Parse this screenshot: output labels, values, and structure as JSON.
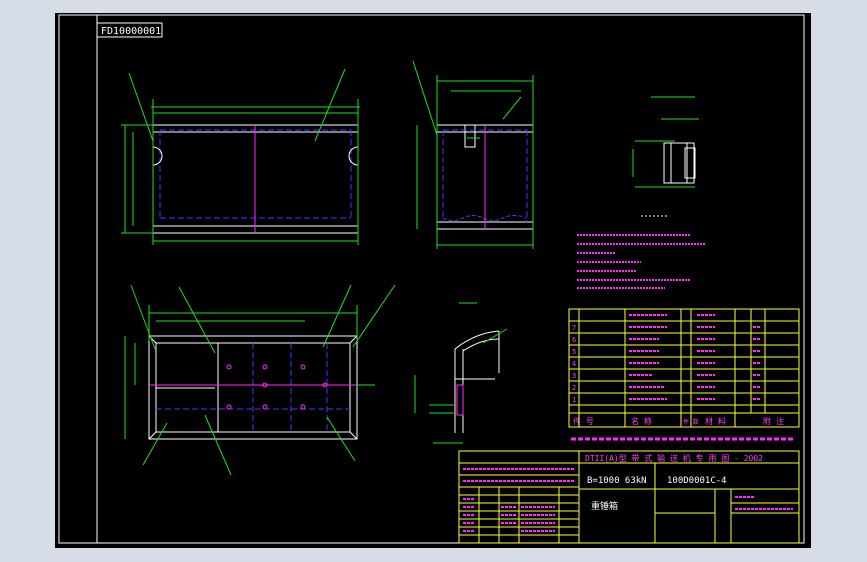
{
  "drawing": {
    "drawing_code": "FD10000001",
    "spec": "B=1000 63kN",
    "drawing_no": "100D0001C-4",
    "standard_title": "DTII(A)型   带 式 输 送 机 专 用 图 - 2002",
    "part_name": "重锤箱",
    "bom_header": [
      "件  号",
      "名    称",
      "件  数",
      "材    料",
      "附    注"
    ],
    "part_numbers": [
      "7",
      "6",
      "5",
      "4",
      "3",
      "2",
      "1"
    ]
  },
  "colors": {
    "background": "#000000",
    "frame": "#ffffff",
    "dimension": "#22dd22",
    "hidden": "#3d3dff",
    "text": "#ff3cff",
    "table": "#ffff33"
  }
}
